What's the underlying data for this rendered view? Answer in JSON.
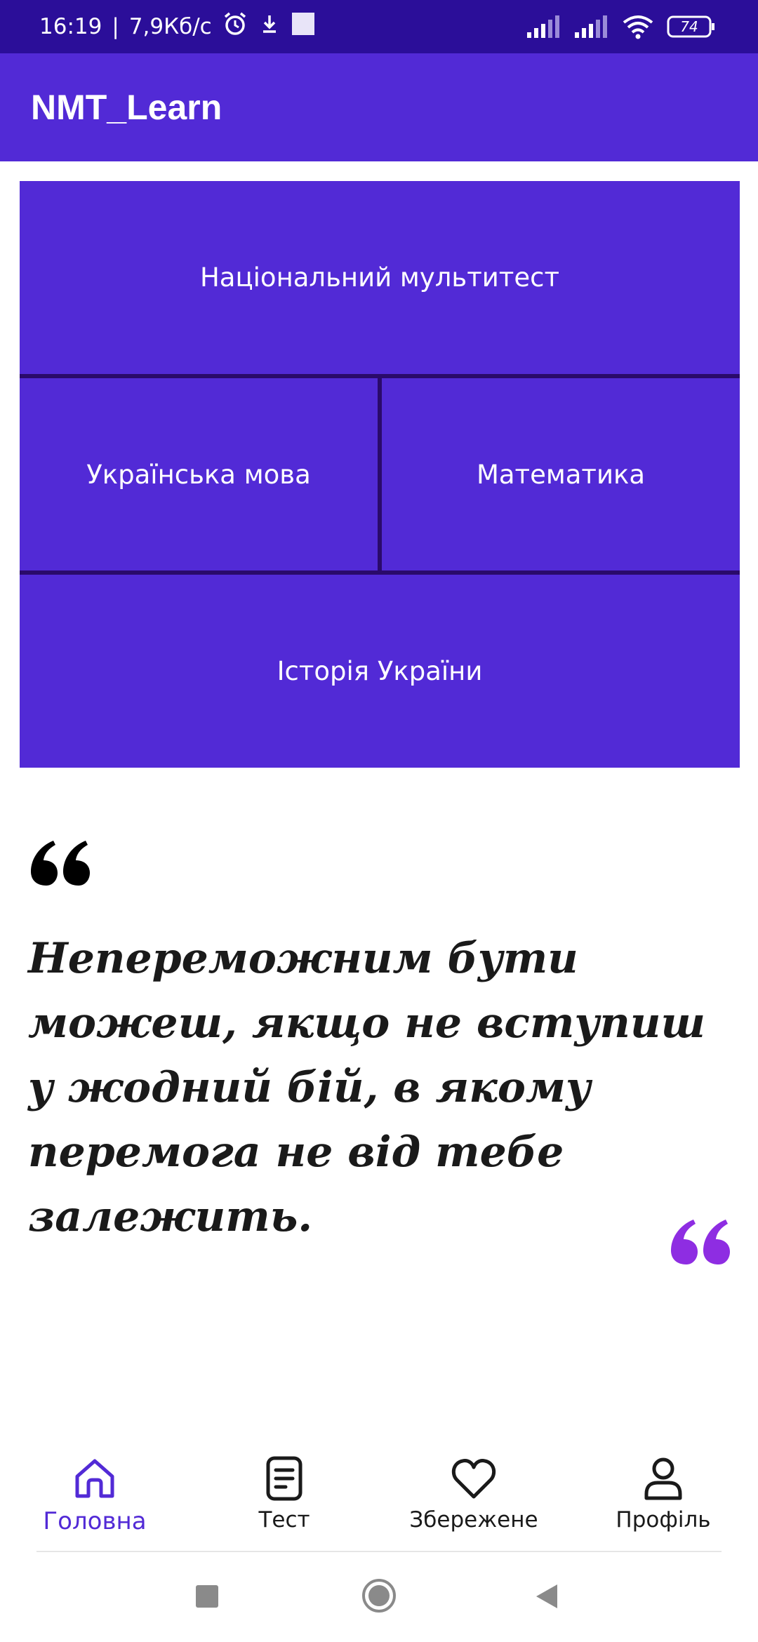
{
  "status_bar": {
    "time": "16:19",
    "separator": "|",
    "speed": "7,9Кб/с",
    "battery": "74"
  },
  "app_bar": {
    "title": "NMT_Learn"
  },
  "subjects": {
    "national": "Національний мультитест",
    "ukrainian": "Українська мова",
    "math": "Математика",
    "history": "Історія України"
  },
  "quote": {
    "text": "Непереможним бути можеш, якщо не вступиш у жодний бій, в якому перемога не від тебе залежить.",
    "open_color": "#000000",
    "close_color": "#8e2de2"
  },
  "bottom_nav": {
    "items": [
      {
        "label": "Головна",
        "icon": "home-icon",
        "active": true
      },
      {
        "label": "Тест",
        "icon": "document-icon",
        "active": false
      },
      {
        "label": "Збережене",
        "icon": "heart-icon",
        "active": false
      },
      {
        "label": "Профіль",
        "icon": "user-icon",
        "active": false
      }
    ]
  },
  "colors": {
    "primary": "#522ad6",
    "status_bar": "#2b0e99",
    "tile_border": "#2a0a6b",
    "accent": "#8e2de2"
  }
}
